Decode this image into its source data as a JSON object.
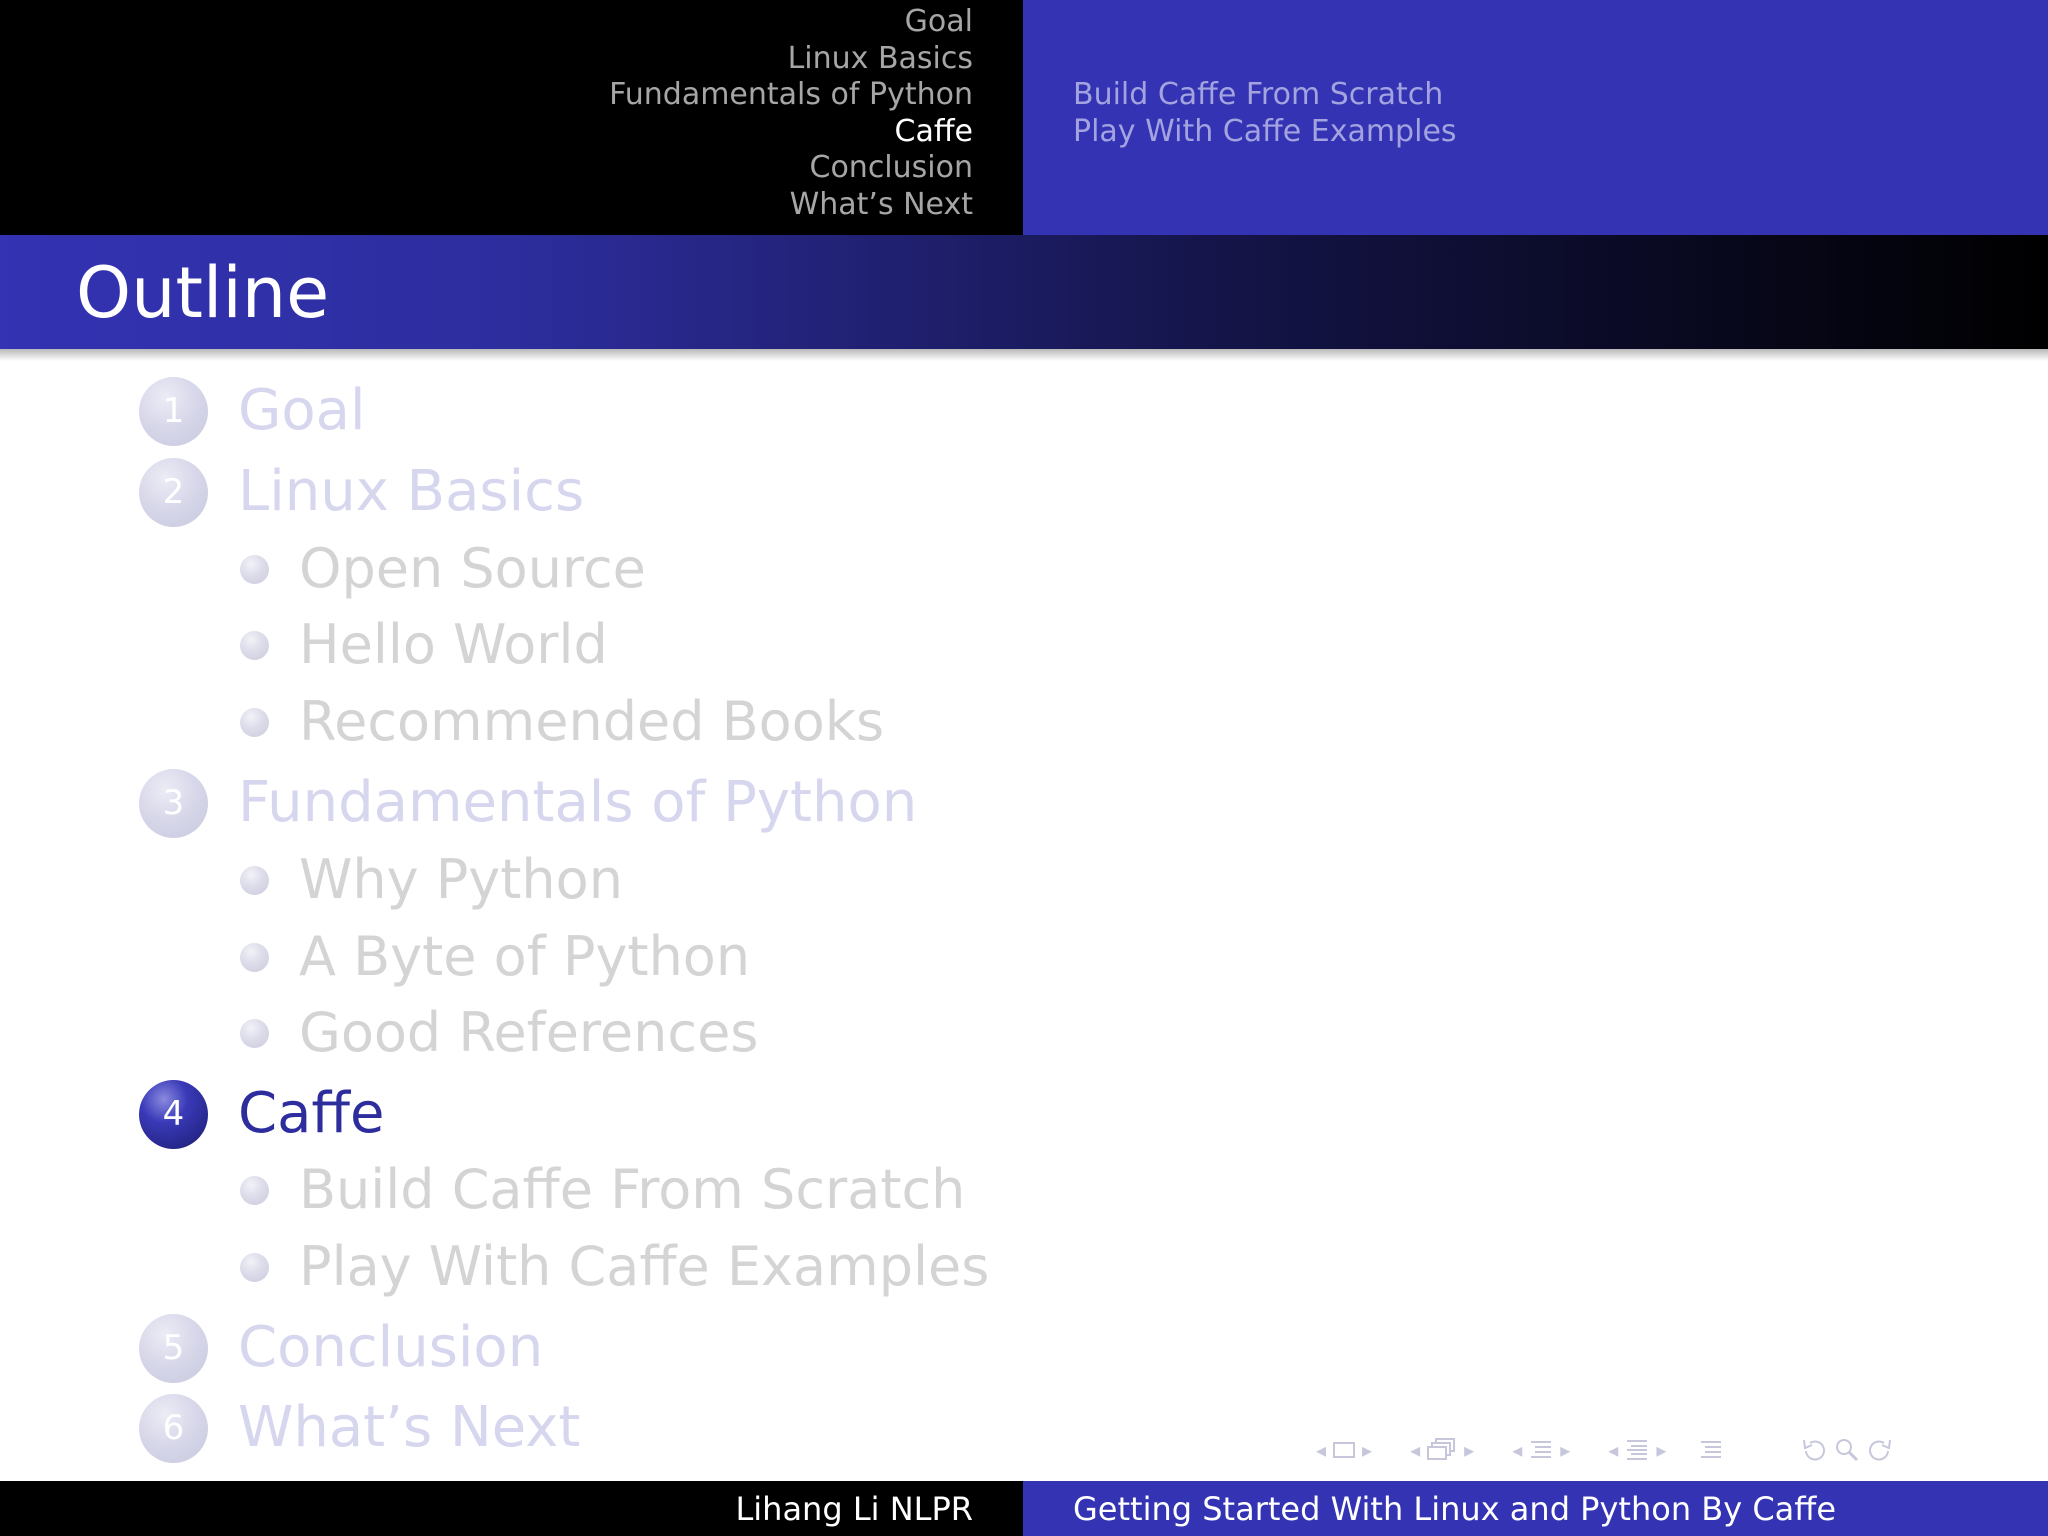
{
  "header": {
    "sections": [
      "Goal",
      "Linux Basics",
      "Fundamentals of Python",
      "Caffe",
      "Conclusion",
      "What’s Next"
    ],
    "current_section": "Caffe",
    "subsections": [
      "Build Caffe From Scratch",
      "Play With Caffe Examples"
    ]
  },
  "frame": {
    "title": "Outline"
  },
  "outline": {
    "sections": [
      {
        "number": "1",
        "label": "Goal",
        "subsections": []
      },
      {
        "number": "2",
        "label": "Linux Basics",
        "subsections": [
          "Open Source",
          "Hello World",
          "Recommended Books"
        ]
      },
      {
        "number": "3",
        "label": "Fundamentals of Python",
        "subsections": [
          "Why Python",
          "A Byte of Python",
          "Good References"
        ]
      },
      {
        "number": "4",
        "label": "Caffe",
        "subsections": [
          "Build Caffe From Scratch",
          "Play With Caffe Examples"
        ]
      },
      {
        "number": "5",
        "label": "Conclusion",
        "subsections": []
      },
      {
        "number": "6",
        "label": "What’s Next",
        "subsections": []
      }
    ],
    "active_section": "4"
  },
  "footer": {
    "author": "Lihang Li  NLPR",
    "title": "Getting Started With Linux and Python By Caffe"
  },
  "nav_icons": [
    "frame-nav-icon",
    "subsection-nav-icon",
    "section-nav-icon",
    "document-nav-icon",
    "toc-icon",
    "back-icon",
    "search-icon",
    "forward-icon"
  ],
  "colors": {
    "structure": "#3333b3",
    "header_black": "#000000",
    "current_section": "#ffffff",
    "inactive_section": "#a6a6a6",
    "active_outline": "#2d2d9e",
    "faded_outline": "#d6d6ee"
  }
}
